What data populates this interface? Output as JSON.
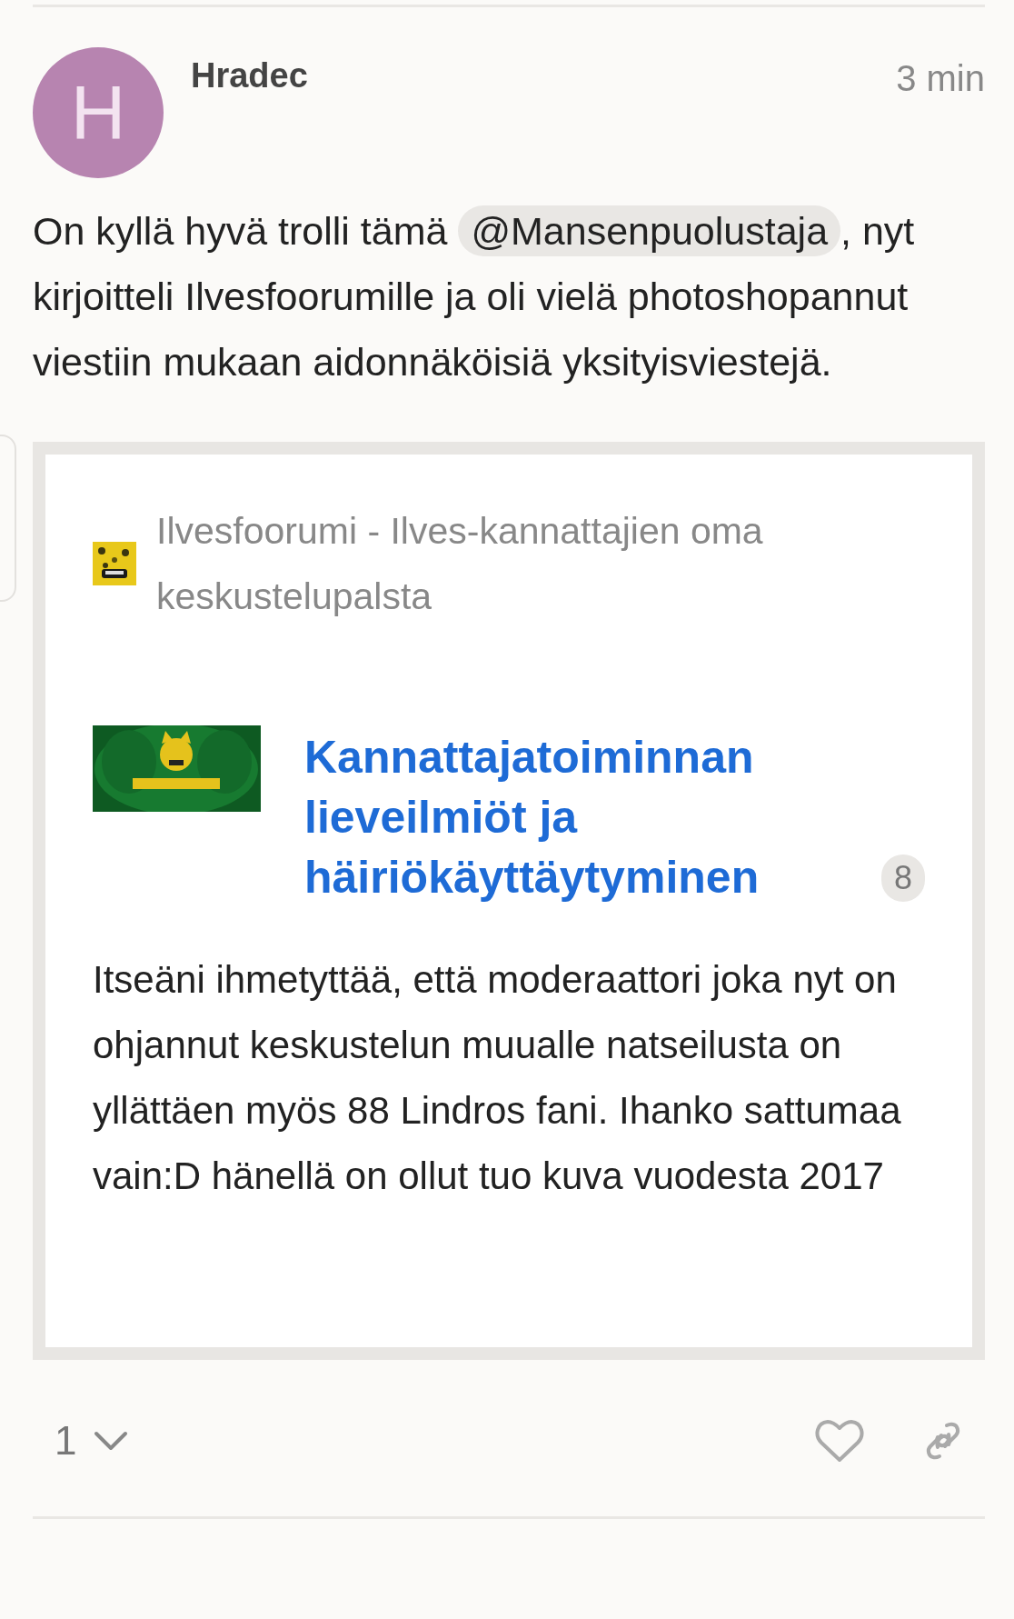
{
  "post": {
    "avatar_letter": "H",
    "username": "Hradec",
    "time": "3 min",
    "text_before": "On kyllä hyvä trolli tämä",
    "mention": "@Mansenpuolustaja",
    "text_after": ", nyt kirjoitteli Ilvesfoorumille ja oli vielä photoshopannut viestiin mukaan aidonnäköisiä yksityisviestejä."
  },
  "onebox": {
    "site": "Ilvesfoorumi - Ilves-kannattajien oma keskustelupalsta",
    "title": "Kannattajatoiminnan lieveilmiöt ja häiriökäyttäytyminen",
    "count": "8",
    "excerpt": "Itseäni ihmetyttää, että moderaattori joka nyt on ohjannut keskustelun muualle natseilusta on yllättäen myös 88 Lindros fani. Ihanko sattumaa vain:D hänellä on ollut tuo kuva vuodesta 2017"
  },
  "footer": {
    "replies": "1",
    "liked": false
  }
}
